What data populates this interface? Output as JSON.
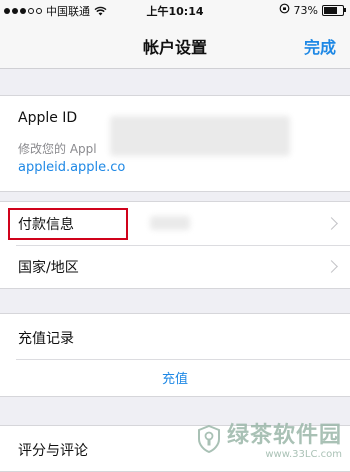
{
  "status_bar": {
    "carrier": "中国联通",
    "time": "上午10:14",
    "battery": "73%",
    "battery_level": 0.73
  },
  "nav": {
    "title": "帐户设置",
    "done_label": "完成"
  },
  "apple_id": {
    "label": "Apple ID",
    "description": "修改您的 Appl",
    "link": "appleid.apple.co"
  },
  "payment": {
    "label": "付款信息"
  },
  "region": {
    "label": "国家/地区"
  },
  "recharge": {
    "history_label": "充值记录",
    "action_label": "充值"
  },
  "rating": {
    "label": "评分与评论"
  },
  "watermark": {
    "text": "绿茶软件园",
    "url": "www.33LC.com"
  },
  "colors": {
    "accent": "#1e88e5",
    "highlight": "#d0021b"
  }
}
